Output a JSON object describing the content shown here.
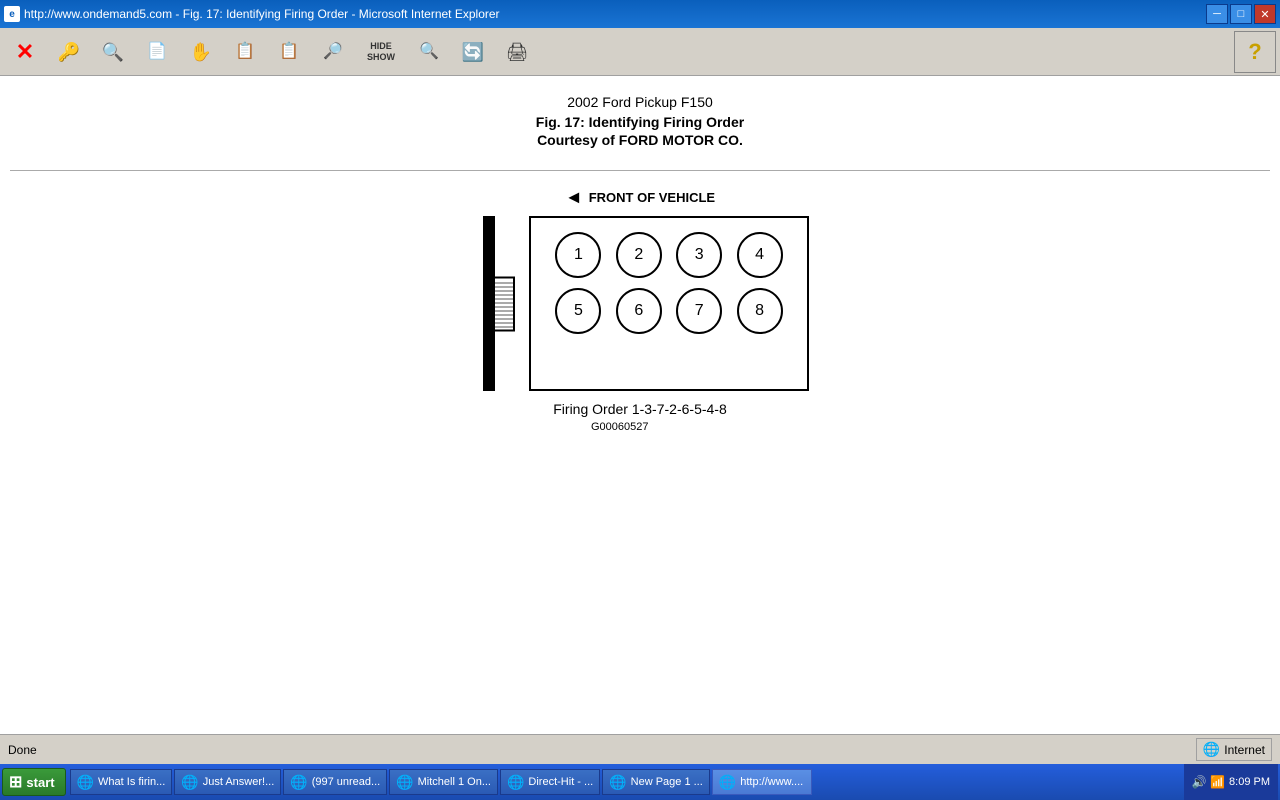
{
  "window": {
    "title": "http://www.ondemand5.com - Fig. 17: Identifying Firing Order - Microsoft Internet Explorer",
    "title_icon": "🌐"
  },
  "toolbar": {
    "buttons": [
      {
        "name": "close-btn",
        "icon": "✕",
        "color": "red"
      },
      {
        "name": "back-btn",
        "icon": "🔑"
      },
      {
        "name": "search-btn",
        "icon": "🔍"
      },
      {
        "name": "fig-btn",
        "icon": "📄"
      },
      {
        "name": "hand-btn",
        "icon": "✋"
      },
      {
        "name": "fig2-btn",
        "icon": "📋"
      },
      {
        "name": "fig3-btn",
        "icon": "📋"
      },
      {
        "name": "find-btn",
        "icon": "🔎"
      },
      {
        "name": "hide-show-btn",
        "label": "HIDE SHOW"
      },
      {
        "name": "print-prev-btn",
        "icon": "🔍"
      },
      {
        "name": "refresh-btn",
        "icon": "🔄"
      },
      {
        "name": "print-btn",
        "icon": "🖨"
      }
    ],
    "help_label": "?"
  },
  "content": {
    "title_line1": "2002 Ford Pickup F150",
    "title_line2": "Fig. 17: Identifying Firing Order",
    "title_line3": "Courtesy of FORD MOTOR CO.",
    "front_label": "FRONT OF VEHICLE",
    "cylinders_top": [
      "①",
      "②",
      "③",
      "④"
    ],
    "cylinders_bottom": [
      "⑤",
      "⑥",
      "⑦",
      "⑧"
    ],
    "firing_order": "Firing Order 1-3-7-2-6-5-4-8",
    "fig_code": "G00060527"
  },
  "status_bar": {
    "done_text": "Done",
    "internet_text": "Internet"
  },
  "taskbar": {
    "start_label": "start",
    "time": "8:09 PM",
    "items": [
      {
        "label": "What Is firin...",
        "icon": "🌐",
        "active": false
      },
      {
        "label": "Just Answer!...",
        "icon": "🌐",
        "active": false
      },
      {
        "label": "(997 unread...",
        "icon": "🌐",
        "active": false
      },
      {
        "label": "Mitchell 1 On...",
        "icon": "🌐",
        "active": false
      },
      {
        "label": "Direct-Hit - ...",
        "icon": "🌐",
        "active": false
      },
      {
        "label": "New Page 1 ...",
        "icon": "🌐",
        "active": false
      },
      {
        "label": "http://www....",
        "icon": "🌐",
        "active": true
      }
    ]
  }
}
